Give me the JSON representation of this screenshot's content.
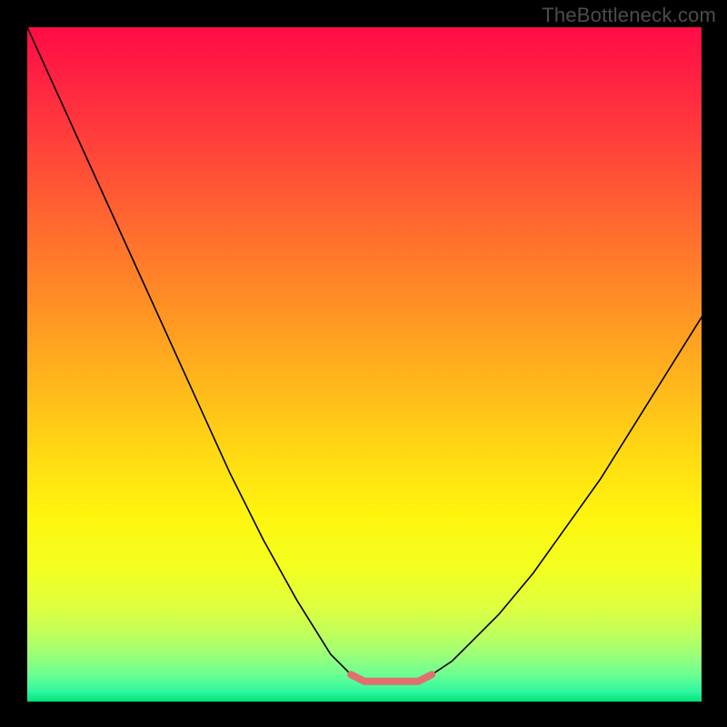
{
  "watermark": "TheBottleneck.com",
  "chart_data": {
    "type": "line",
    "title": "",
    "xlabel": "",
    "ylabel": "",
    "xlim": [
      0,
      100
    ],
    "ylim": [
      0,
      100
    ],
    "x": [
      0,
      5,
      10,
      15,
      20,
      25,
      30,
      35,
      40,
      45,
      48,
      50,
      52,
      55,
      58,
      60,
      63,
      65,
      70,
      75,
      80,
      85,
      90,
      95,
      100
    ],
    "values": [
      100,
      89,
      78,
      67,
      56,
      45,
      34,
      24,
      15,
      7,
      4,
      3,
      3,
      3,
      3,
      4,
      6,
      8,
      13,
      19,
      26,
      33,
      41,
      49,
      57
    ],
    "grid": false,
    "legend": false,
    "series_color": "#000000",
    "flat_segment_color": "#e07070",
    "flat_segment_x_range": [
      48,
      62
    ],
    "background_gradient_stops": [
      {
        "pos": 0.0,
        "color": "#ff0d46"
      },
      {
        "pos": 0.05,
        "color": "#ff1a44"
      },
      {
        "pos": 0.15,
        "color": "#ff3a3c"
      },
      {
        "pos": 0.25,
        "color": "#ff5b33"
      },
      {
        "pos": 0.35,
        "color": "#ff7c2a"
      },
      {
        "pos": 0.45,
        "color": "#ff9d22"
      },
      {
        "pos": 0.55,
        "color": "#ffbe1a"
      },
      {
        "pos": 0.65,
        "color": "#ffdf12"
      },
      {
        "pos": 0.72,
        "color": "#fff40e"
      },
      {
        "pos": 0.8,
        "color": "#f4ff20"
      },
      {
        "pos": 0.86,
        "color": "#deff40"
      },
      {
        "pos": 0.9,
        "color": "#c0ff5c"
      },
      {
        "pos": 0.93,
        "color": "#9cff78"
      },
      {
        "pos": 0.96,
        "color": "#6cff92"
      },
      {
        "pos": 0.985,
        "color": "#30f7a0"
      },
      {
        "pos": 1.0,
        "color": "#00e37a"
      }
    ]
  }
}
